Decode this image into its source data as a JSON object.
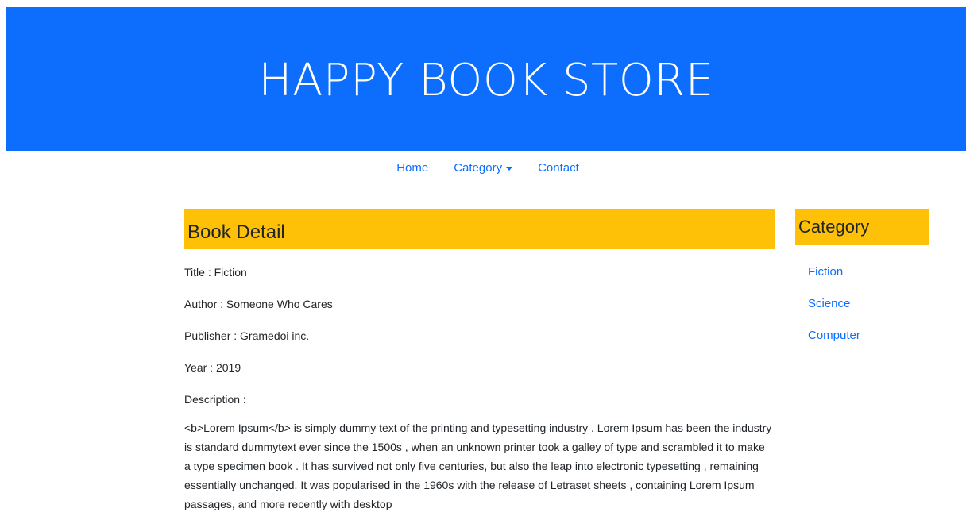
{
  "header": {
    "title": "HAPPY BOOK STORE"
  },
  "nav": {
    "home": "Home",
    "category": "Category",
    "contact": "Contact"
  },
  "detail": {
    "heading": "Book Detail",
    "title": "Title : Fiction",
    "author": "Author : Someone Who Cares",
    "publisher": "Publisher : Gramedoi inc.",
    "year": "Year : 2019",
    "description_label": "Description :",
    "description": "<b>Lorem Ipsum</b> is simply dummy text of the printing and typesetting industry . Lorem Ipsum has been the industry is standard dummytext ever since the 1500s , when an unknown printer took a galley of type and scrambled it to make a type specimen book . It has survived not only five centuries, but also the leap into electronic typesetting , remaining essentially unchanged. It was popularised in the 1960s with the release of Letraset sheets , containing Lorem Ipsum passages, and more recently with desktop"
  },
  "sidebar": {
    "heading": "Category",
    "items": [
      {
        "label": "Fiction"
      },
      {
        "label": "Science"
      },
      {
        "label": "Computer"
      }
    ]
  },
  "colors": {
    "banner": "#0d6efd",
    "section_header": "#ffc107",
    "link": "#0d6efd"
  }
}
